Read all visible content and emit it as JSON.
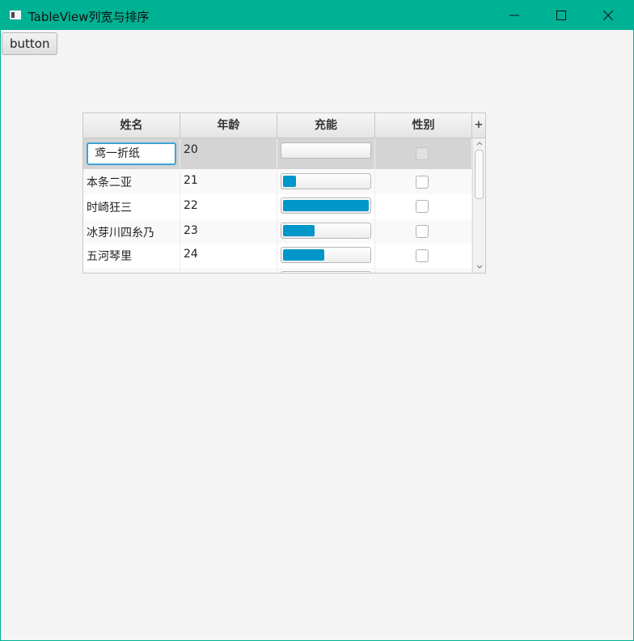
{
  "window": {
    "title": "TableView列宽与排序"
  },
  "toolbar": {
    "button_label": "button"
  },
  "table": {
    "columns": [
      "姓名",
      "年龄",
      "充能",
      "性别"
    ],
    "menu_button": "+",
    "rows": [
      {
        "name": "鸢一折纸",
        "age": "20",
        "progress": 0.0,
        "checked": false,
        "editing": true
      },
      {
        "name": "本条二亚",
        "age": "21",
        "progress": 0.15,
        "checked": false
      },
      {
        "name": "时崎狂三",
        "age": "22",
        "progress": 1.0,
        "checked": false
      },
      {
        "name": "冰芽川四糸乃",
        "age": "23",
        "progress": 0.37,
        "checked": false
      },
      {
        "name": "五河琴里",
        "age": "24",
        "progress": 0.48,
        "checked": false
      }
    ]
  },
  "colors": {
    "titlebar": "#00b294",
    "progress_fill": "#0096c9",
    "focus_border": "#3ba4d8"
  }
}
